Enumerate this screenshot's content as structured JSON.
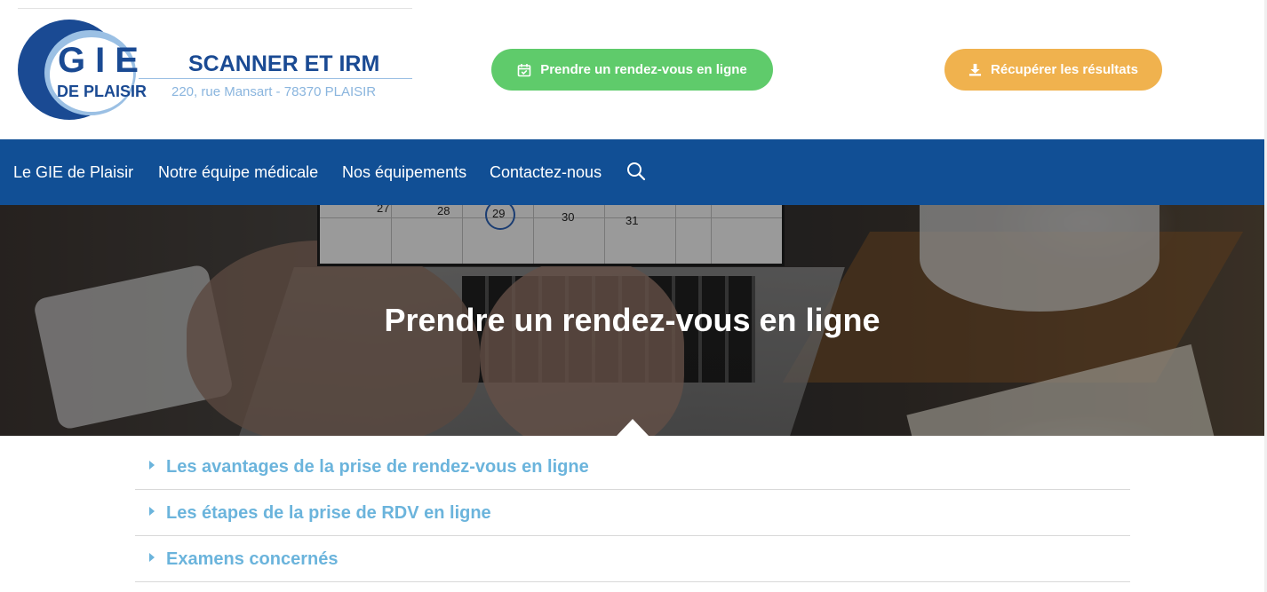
{
  "logo": {
    "gie": "GIE",
    "de_plaisir": "DE PLAISIR",
    "tagline": "SCANNER ET IRM",
    "address": "220, rue Mansart - 78370 PLAISIR"
  },
  "header_buttons": {
    "appointment": {
      "label": "Prendre un rendez-vous en ligne",
      "icon": "calendar-check-icon",
      "color": "#5fcb6b"
    },
    "results": {
      "label": "Récupérer les résultats",
      "icon": "download-icon",
      "color": "#f0b24e"
    }
  },
  "nav": {
    "background": "#114f95",
    "items": [
      {
        "label": "Le GIE de Plaisir"
      },
      {
        "label": "Notre équipe médicale"
      },
      {
        "label": "Nos équipements"
      },
      {
        "label": "Contactez-nous"
      }
    ],
    "search_icon": "search-icon"
  },
  "hero": {
    "title": "Prendre un rendez-vous en ligne",
    "calendar_days": [
      "27",
      "28",
      "29",
      "30",
      "31"
    ]
  },
  "accordion": {
    "accent": "#6bb4dc",
    "items": [
      {
        "label": "Les avantages de la prise de rendez-vous en ligne"
      },
      {
        "label": "Les étapes de la prise de RDV en ligne"
      },
      {
        "label": "Examens concernés"
      }
    ]
  }
}
